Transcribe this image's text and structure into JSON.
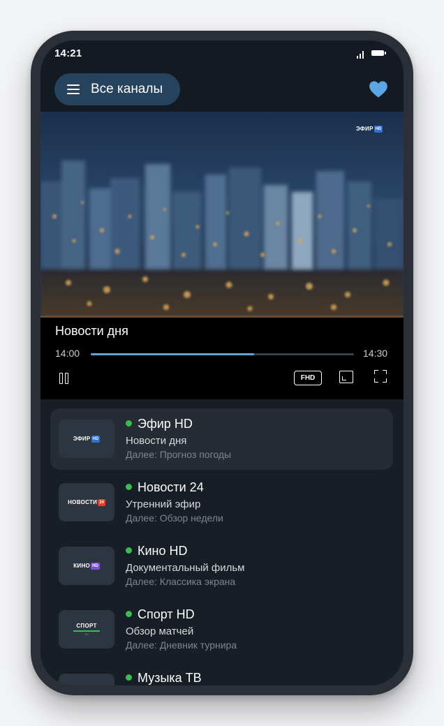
{
  "status_bar": {
    "time": "14:21"
  },
  "header": {
    "menu_label": "Все каналы",
    "favorite_icon": "heart-icon",
    "accent": "#5aa7e4"
  },
  "player": {
    "watermark_name": "ЭФИР",
    "watermark_badge": "HD",
    "program_title": "Новости дня",
    "start_time": "14:00",
    "end_time": "14:30",
    "progress": 0.62,
    "quality_label": "FHD",
    "progress_color": "#5fa3dc"
  },
  "channels": [
    {
      "logo_text": "ЭФИР",
      "logo_badge": "HD",
      "badge_color": "#2f6fd6",
      "name": "Эфир HD",
      "program": "Новости дня",
      "next": "Далее: Прогноз погоды",
      "active": true
    },
    {
      "logo_text": "НОВОСТИ",
      "logo_badge": "24",
      "badge_color": "#e0402c",
      "name": "Новости 24",
      "program": "Утренний эфир",
      "next": "Далее: Обзор недели",
      "active": false
    },
    {
      "logo_text": "КИНО",
      "logo_badge": "HD",
      "badge_color": "#7c52d6",
      "name": "Кино HD",
      "program": "Документальный фильм",
      "next": "Далее: Классика экрана",
      "active": false
    },
    {
      "logo_text": "СПОРТ",
      "logo_sub": "HD",
      "name": "Спорт HD",
      "program": "Обзор матчей",
      "next": "Далее: Дневник турнира",
      "active": false
    },
    {
      "name": "Музыка ТВ",
      "active": false
    }
  ],
  "live_indicator_color": "#3cba54"
}
